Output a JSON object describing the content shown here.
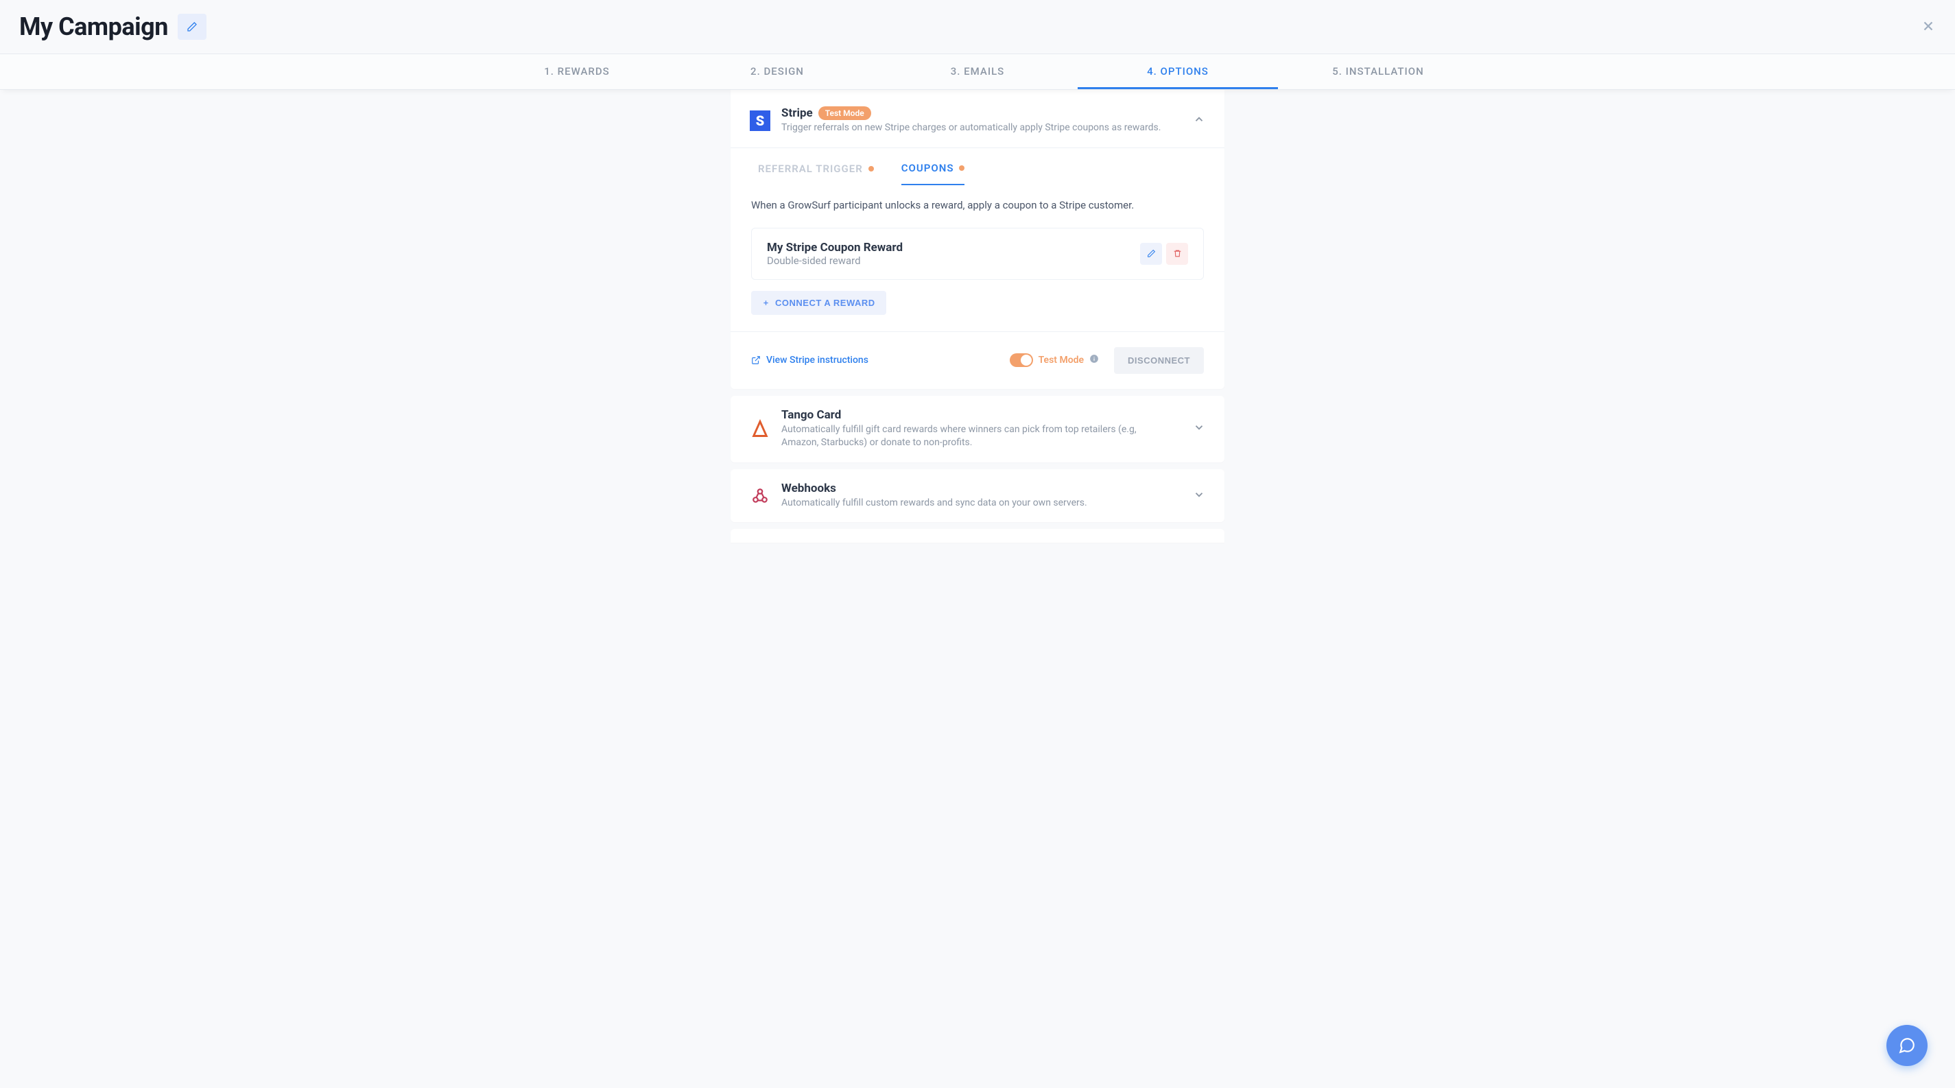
{
  "header": {
    "title": "My Campaign"
  },
  "tabs": [
    {
      "label": "1. REWARDS",
      "active": false
    },
    {
      "label": "2. DESIGN",
      "active": false
    },
    {
      "label": "3. EMAILS",
      "active": false
    },
    {
      "label": "4. OPTIONS",
      "active": true
    },
    {
      "label": "5. INSTALLATION",
      "active": false
    }
  ],
  "stripe": {
    "title": "Stripe",
    "badge": "Test Mode",
    "description": "Trigger referrals on new Stripe charges or automatically apply Stripe coupons as rewards.",
    "subtabs": {
      "referral": "REFERRAL TRIGGER",
      "coupons": "COUPONS"
    },
    "coupon_desc": "When a GrowSurf participant unlocks a reward, apply a coupon to a Stripe customer.",
    "reward": {
      "title": "My Stripe Coupon Reward",
      "subtitle": "Double-sided reward"
    },
    "connect_label": "CONNECT A REWARD",
    "view_link": "View Stripe instructions",
    "test_mode_label": "Test Mode",
    "disconnect_label": "DISCONNECT"
  },
  "tango": {
    "title": "Tango Card",
    "description": "Automatically fulfill gift card rewards where winners can pick from top retailers (e.g, Amazon, Starbucks) or donate to non-profits."
  },
  "webhooks": {
    "title": "Webhooks",
    "description": "Automatically fulfill custom rewards and sync data on your own servers."
  }
}
